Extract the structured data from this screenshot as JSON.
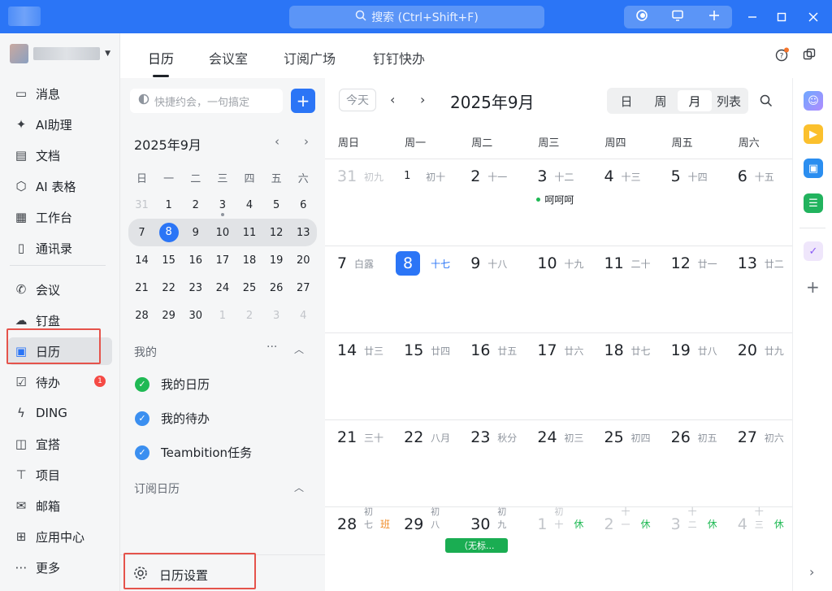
{
  "titlebar": {
    "search_placeholder": "搜索 (Ctrl+Shift+F)"
  },
  "nav": {
    "items": [
      {
        "label": "消息",
        "icon": "message-icon"
      },
      {
        "label": "AI助理",
        "icon": "ai-assistant-icon"
      },
      {
        "label": "文档",
        "icon": "document-icon"
      },
      {
        "label": "AI 表格",
        "icon": "ai-table-icon"
      },
      {
        "label": "工作台",
        "icon": "workbench-icon"
      },
      {
        "label": "通讯录",
        "icon": "contacts-icon"
      },
      {
        "label": "会议",
        "icon": "meeting-icon"
      },
      {
        "label": "钉盘",
        "icon": "cloud-drive-icon"
      },
      {
        "label": "日历",
        "icon": "calendar-icon"
      },
      {
        "label": "待办",
        "icon": "todo-icon",
        "badge": "1"
      },
      {
        "label": "DING",
        "icon": "ding-icon"
      },
      {
        "label": "宜搭",
        "icon": "yida-icon"
      },
      {
        "label": "项目",
        "icon": "project-icon"
      },
      {
        "label": "邮箱",
        "icon": "mail-icon"
      },
      {
        "label": "应用中心",
        "icon": "app-center-icon"
      },
      {
        "label": "更多",
        "icon": "more-icon"
      }
    ]
  },
  "tabs": [
    "日历",
    "会议室",
    "订阅广场",
    "钉钉快办"
  ],
  "panel": {
    "quick_create_placeholder": "快捷约会，一句搞定",
    "mini_title": "2025年9月",
    "weekdays": [
      "日",
      "一",
      "二",
      "三",
      "四",
      "五",
      "六"
    ],
    "weeks": [
      [
        "31",
        "1",
        "2",
        "3",
        "4",
        "5",
        "6"
      ],
      [
        "7",
        "8",
        "9",
        "10",
        "11",
        "12",
        "13"
      ],
      [
        "14",
        "15",
        "16",
        "17",
        "18",
        "19",
        "20"
      ],
      [
        "21",
        "22",
        "23",
        "24",
        "25",
        "26",
        "27"
      ],
      [
        "28",
        "29",
        "30",
        "1",
        "2",
        "3",
        "4"
      ]
    ],
    "mine_title": "我的",
    "calendars": [
      {
        "label": "我的日历",
        "color": "#1fb954"
      },
      {
        "label": "我的待办",
        "color": "#3b8ff0"
      },
      {
        "label": "Teambition任务",
        "color": "#3b8ff0"
      }
    ],
    "subscribed_title": "订阅日历",
    "settings_label": "日历设置"
  },
  "main": {
    "today_label": "今天",
    "title": "2025年9月",
    "views": [
      "日",
      "周",
      "月",
      "列表"
    ],
    "week_headers": [
      "周日",
      "周一",
      "周二",
      "周三",
      "周四",
      "周五",
      "周六"
    ],
    "rows": [
      [
        {
          "d": "31",
          "l": "初九"
        },
        {
          "d": "1",
          "l": "初十"
        },
        {
          "d": "2",
          "l": "十一"
        },
        {
          "d": "3",
          "l": "十二"
        },
        {
          "d": "4",
          "l": "十三"
        },
        {
          "d": "5",
          "l": "十四"
        },
        {
          "d": "6",
          "l": "十五"
        }
      ],
      [
        {
          "d": "7",
          "l": "白露"
        },
        {
          "d": "8",
          "l": "十七"
        },
        {
          "d": "9",
          "l": "十八"
        },
        {
          "d": "10",
          "l": "十九"
        },
        {
          "d": "11",
          "l": "二十"
        },
        {
          "d": "12",
          "l": "廿一"
        },
        {
          "d": "13",
          "l": "廿二"
        }
      ],
      [
        {
          "d": "14",
          "l": "廿三"
        },
        {
          "d": "15",
          "l": "廿四"
        },
        {
          "d": "16",
          "l": "廿五"
        },
        {
          "d": "17",
          "l": "廿六"
        },
        {
          "d": "18",
          "l": "廿七"
        },
        {
          "d": "19",
          "l": "廿八"
        },
        {
          "d": "20",
          "l": "廿九"
        }
      ],
      [
        {
          "d": "21",
          "l": "三十"
        },
        {
          "d": "22",
          "l": "八月"
        },
        {
          "d": "23",
          "l": "秋分"
        },
        {
          "d": "24",
          "l": "初三"
        },
        {
          "d": "25",
          "l": "初四"
        },
        {
          "d": "26",
          "l": "初五"
        },
        {
          "d": "27",
          "l": "初六"
        }
      ],
      [
        {
          "d": "28",
          "l": "初七"
        },
        {
          "d": "29",
          "l": "初八"
        },
        {
          "d": "30",
          "l": "初九"
        },
        {
          "d": "1",
          "l": "初十"
        },
        {
          "d": "2",
          "l": "十一"
        },
        {
          "d": "3",
          "l": "十二"
        },
        {
          "d": "4",
          "l": "十三"
        }
      ]
    ],
    "holiday_tags": {
      "work": "班",
      "rest": "休"
    },
    "event_sep3": "呵呵呵",
    "event_sep30": "（无标..."
  }
}
